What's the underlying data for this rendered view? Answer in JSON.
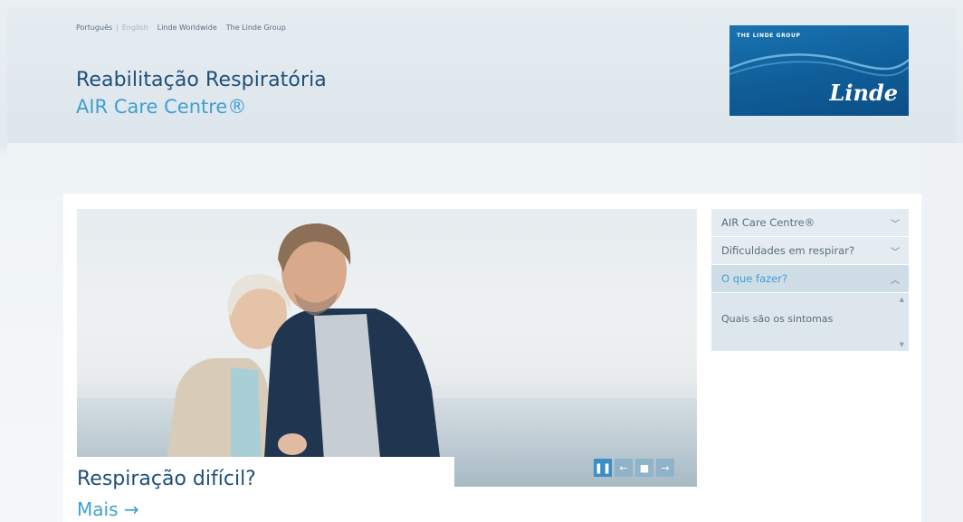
{
  "header": {
    "top_links": {
      "lang_portugues": "Português",
      "lang_separator": "|",
      "lang_english": "English",
      "linde_worldwide": "Linde Worldwide",
      "linde_group": "The Linde Group"
    },
    "title": "Reabilitação Respiratória",
    "subtitle": "AIR Care Centre®",
    "logo": {
      "group_text": "THE LINDE GROUP",
      "brand_text": "Linde",
      "color": "#1270ad"
    }
  },
  "hero": {
    "image": "senior-couple-by-the-sea",
    "caption_title": "Respiração difícil?",
    "caption_link": "Mais →",
    "controls": {
      "pause_icon": "pause-icon",
      "pause": "❚❚",
      "prev": "←",
      "stop": "■",
      "next": "→"
    }
  },
  "sidenav": {
    "items": [
      {
        "label": "AIR Care Centre®",
        "icon": "chevron-down-icon",
        "glyph": "﹀",
        "expanded": false
      },
      {
        "label": "Dificuldades em respirar?",
        "icon": "chevron-down-icon",
        "glyph": "﹀",
        "expanded": false
      },
      {
        "label": "O que fazer?",
        "icon": "chevron-up-icon",
        "glyph": "︿",
        "expanded": true
      }
    ],
    "subitems": [
      {
        "label": "Quais são os sintomas"
      }
    ],
    "scroll_up": "▲",
    "scroll_down": "▼"
  },
  "colors": {
    "title_blue": "#1e4f7a",
    "accent_blue": "#3f9fd4",
    "nav_bg": "#e4ecf1",
    "control_bg": "#8fb3c8"
  }
}
